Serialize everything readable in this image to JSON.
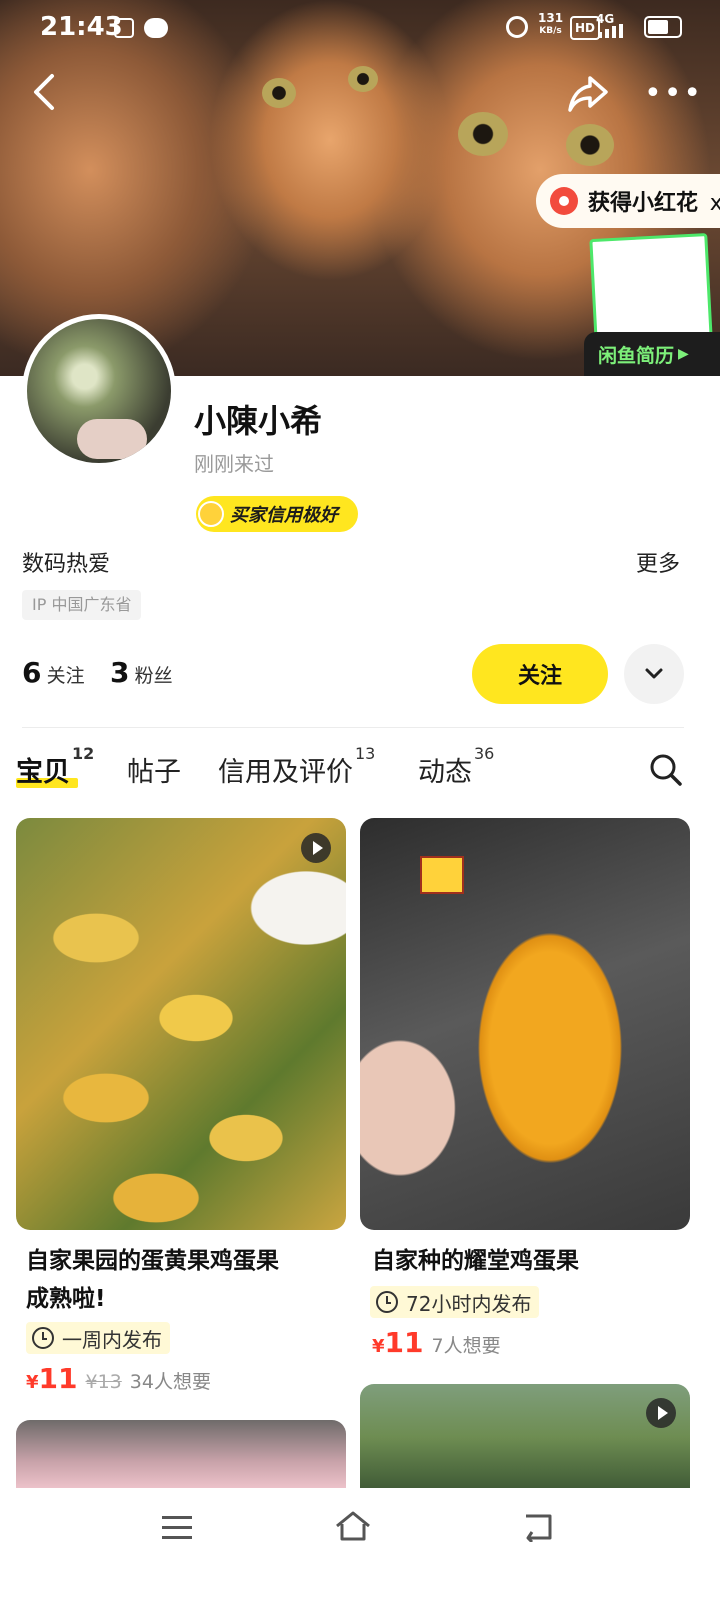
{
  "status_bar": {
    "time": "21:43",
    "speed": "131",
    "speed_unit": "KB/s",
    "hd": "HD",
    "network": "4G"
  },
  "header": {
    "back_icon": "chevron-left-icon",
    "share_icon": "share-icon",
    "more_icon": "more-dots-icon"
  },
  "promo": {
    "reward_text": "获得小红花",
    "reward_close": "x",
    "resume_label": "闲鱼简历"
  },
  "profile": {
    "username": "小陳小希",
    "last_seen": "刚刚来过",
    "credit_badge": "买家信用极好",
    "bio": "数码热爱",
    "more_label": "更多",
    "ip_location": "IP 中国广东省",
    "following_count": "6",
    "following_label": "关注",
    "followers_count": "3",
    "followers_label": "粉丝",
    "follow_button": "关注"
  },
  "tabs": [
    {
      "label": "宝贝",
      "count": "12",
      "active": true
    },
    {
      "label": "帖子",
      "count": "",
      "active": false
    },
    {
      "label": "信用及评价",
      "count": "13",
      "active": false
    },
    {
      "label": "动态",
      "count": "36",
      "active": false
    }
  ],
  "items": [
    {
      "title_line1": "自家果园的蛋黄果鸡蛋果",
      "title_line2": "成熟啦!",
      "time_tag": "一周内发布",
      "currency": "¥",
      "price": "11",
      "original_price": "¥13",
      "wants": "34人想要",
      "has_video": true
    },
    {
      "title_line1": "自家种的耀堂鸡蛋果",
      "time_tag": "72小时内发布",
      "currency": "¥",
      "price": "11",
      "wants": "7人想要",
      "has_video": false
    }
  ],
  "colors": {
    "accent_yellow": "#ffe61f",
    "price_red": "#ff3a2a",
    "resume_green": "#7df07a"
  }
}
